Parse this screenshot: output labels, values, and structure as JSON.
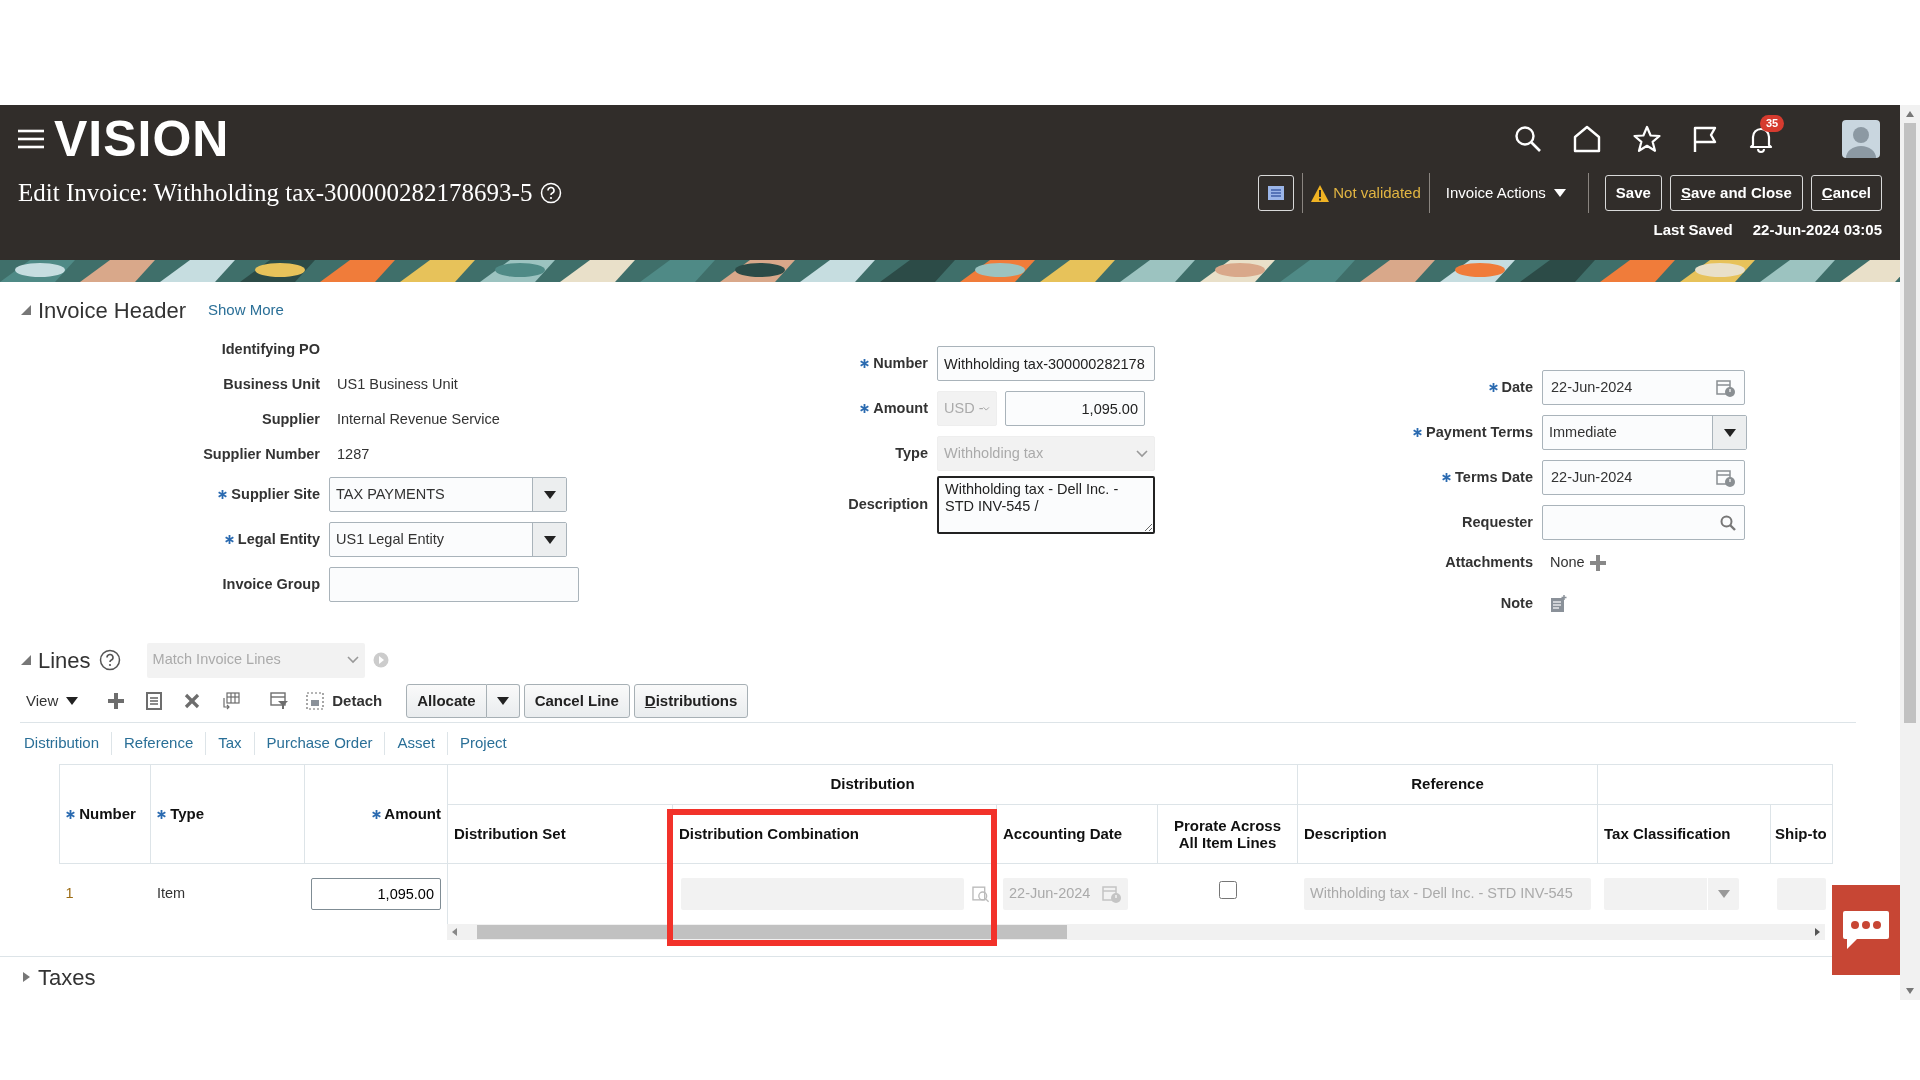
{
  "header": {
    "logo": "VISION",
    "notification_count": "35",
    "title": "Edit Invoice: Withholding tax-300000282178693-5",
    "status": {
      "label": "Not validated",
      "validated": false
    },
    "actions_menu": "Invoice Actions",
    "buttons": [
      {
        "label": "Save",
        "underline_first": false
      },
      {
        "label": "Save and Close",
        "underline_first": true
      },
      {
        "label": "Cancel",
        "underline_first": true
      }
    ],
    "last_saved_label": "Last Saved",
    "last_saved_value": "22-Jun-2024 03:05"
  },
  "invoice_header": {
    "title": "Invoice Header",
    "expanded": true,
    "show_more": "Show More",
    "columns": [
      [
        {
          "label": "Identifying PO",
          "required": false,
          "kind": "text"
        },
        {
          "label": "Business Unit",
          "required": false,
          "kind": "text",
          "value": "US1 Business Unit"
        },
        {
          "label": "Supplier",
          "required": false,
          "kind": "text",
          "value": "Internal Revenue Service"
        },
        {
          "label": "Supplier Number",
          "required": false,
          "kind": "text",
          "value": "1287"
        },
        {
          "label": "Supplier Site",
          "required": true,
          "kind": "select",
          "value": "TAX PAYMENTS"
        },
        {
          "label": "Legal Entity",
          "required": true,
          "kind": "select",
          "value": "US1 Legal Entity"
        },
        {
          "label": "Invoice Group",
          "required": false,
          "kind": "input"
        }
      ],
      [
        {
          "label": "Number",
          "required": true,
          "kind": "input",
          "value": "Withholding tax-300000282178"
        },
        {
          "label": "Amount",
          "required": true,
          "kind": "amount",
          "currency": "USD -",
          "currency_disabled": true,
          "value": "1,095.00"
        },
        {
          "label": "Type",
          "required": false,
          "kind": "choice",
          "value": "Withholding tax",
          "disabled": true
        },
        {
          "label": "Description",
          "required": false,
          "kind": "textarea",
          "value": "Withholding tax - Dell Inc. - STD INV-545 /"
        }
      ],
      [
        {
          "label": "Date",
          "required": true,
          "kind": "date",
          "value": "22-Jun-2024"
        },
        {
          "label": "Payment Terms",
          "required": true,
          "kind": "select",
          "value": "Immediate"
        },
        {
          "label": "Terms Date",
          "required": true,
          "kind": "date",
          "value": "22-Jun-2024"
        },
        {
          "label": "Requester",
          "required": false,
          "kind": "search"
        },
        {
          "label": "Attachments",
          "required": false,
          "kind": "attachments",
          "value": "None"
        },
        {
          "label": "Note",
          "required": false,
          "kind": "note"
        }
      ]
    ]
  },
  "lines": {
    "title": "Lines",
    "expanded": true,
    "match_select": {
      "placeholder": "Match Invoice Lines",
      "disabled": true
    },
    "view_menu": "View",
    "detach": "Detach",
    "buttons": [
      {
        "label": "Allocate",
        "split": true,
        "underline_first": false
      },
      {
        "label": "Cancel Line",
        "split": false,
        "underline_first": false
      },
      {
        "label": "Distributions",
        "split": false,
        "underline_first": true
      }
    ],
    "column_sets": [
      "Distribution",
      "Reference",
      "Tax",
      "Purchase Order",
      "Asset",
      "Project"
    ],
    "table": {
      "column_groups": [
        {
          "kind": "single",
          "columns": [
            {
              "label": "Number",
              "required": true,
              "highlighted": false
            },
            {
              "label": "Type",
              "required": true,
              "highlighted": false
            },
            {
              "label": "Amount",
              "required": true,
              "highlighted": false
            }
          ]
        },
        {
          "kind": "group",
          "label": "Distribution",
          "columns": [
            {
              "label": "Distribution Set",
              "required": false,
              "highlighted": false
            },
            {
              "label": "Distribution Combination",
              "required": false,
              "highlighted": true
            },
            {
              "label": "Accounting Date",
              "required": false,
              "highlighted": false
            },
            {
              "label": "Prorate Across All Item Lines",
              "required": false,
              "highlighted": false
            }
          ]
        },
        {
          "kind": "group",
          "label": "Reference",
          "columns": [
            {
              "label": "Description",
              "required": false,
              "highlighted": false
            }
          ]
        },
        {
          "kind": "group",
          "columns": [
            {
              "label": "Tax Classification",
              "required": false,
              "highlighted": false
            },
            {
              "label": "Ship-to",
              "required": false,
              "highlighted": false
            }
          ]
        }
      ],
      "rows": [
        {
          "cells": [
            {
              "kind": "text",
              "value": "1"
            },
            {
              "kind": "text",
              "value": "Item"
            },
            {
              "kind": "input",
              "value": "1,095.00",
              "disabled": false
            },
            {
              "kind": "empty"
            },
            {
              "kind": "lookup",
              "disabled": true
            },
            {
              "kind": "date",
              "value": "22-Jun-2024",
              "disabled": true
            },
            {
              "kind": "checkbox",
              "checked": false
            },
            {
              "kind": "input",
              "value": "Withholding tax - Dell Inc. - STD INV-545",
              "disabled": true
            },
            {
              "kind": "select",
              "disabled": true
            },
            {
              "kind": "input",
              "disabled": true
            }
          ]
        }
      ]
    }
  },
  "taxes": {
    "title": "Taxes",
    "expanded": false
  }
}
